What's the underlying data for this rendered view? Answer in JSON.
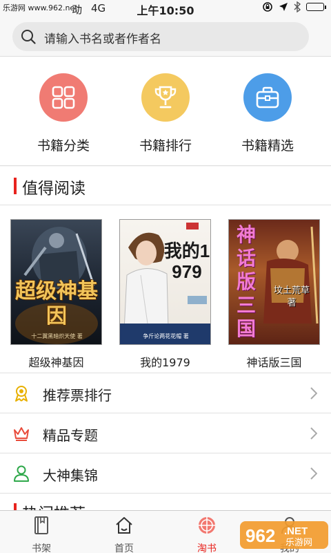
{
  "status_bar": {
    "watermark": "乐游网 www.962.net",
    "carrier": "动",
    "network": "4G",
    "time": "上午10:50"
  },
  "search": {
    "placeholder": "请输入书名或者作者名"
  },
  "categories": [
    {
      "label": "书籍分类",
      "icon": "grid-icon",
      "color": "#f07b73"
    },
    {
      "label": "书籍排行",
      "icon": "trophy-icon",
      "color": "#f4c95f"
    },
    {
      "label": "书籍精选",
      "icon": "briefcase-icon",
      "color": "#4d9de8"
    }
  ],
  "section_recommend": {
    "title": "值得阅读"
  },
  "books": [
    {
      "title": "超级神基因",
      "cover_text": "超级神基因",
      "cover_author": "十二翼黑暗炽天使 著"
    },
    {
      "title": "我的1979",
      "cover_text": "我的1979",
      "cover_author": "争斤论两花花帽 著"
    },
    {
      "title": "神话版三国",
      "cover_text": "神话版三国",
      "cover_author": "坟土荒草 著"
    }
  ],
  "list_items": [
    {
      "label": "推荐票排行",
      "icon": "ribbon-icon"
    },
    {
      "label": "精品专题",
      "icon": "crown-icon"
    },
    {
      "label": "大神集锦",
      "icon": "person-icon"
    }
  ],
  "section_hot": {
    "title": "热门推荐"
  },
  "tabs": [
    {
      "label": "书架",
      "icon": "bookshelf-icon",
      "active": false
    },
    {
      "label": "首页",
      "icon": "home-icon",
      "active": false
    },
    {
      "label": "淘书",
      "icon": "explore-icon",
      "active": true
    },
    {
      "label": "我的",
      "icon": "profile-icon",
      "active": false
    }
  ],
  "colors": {
    "accent": "#e8231e"
  }
}
